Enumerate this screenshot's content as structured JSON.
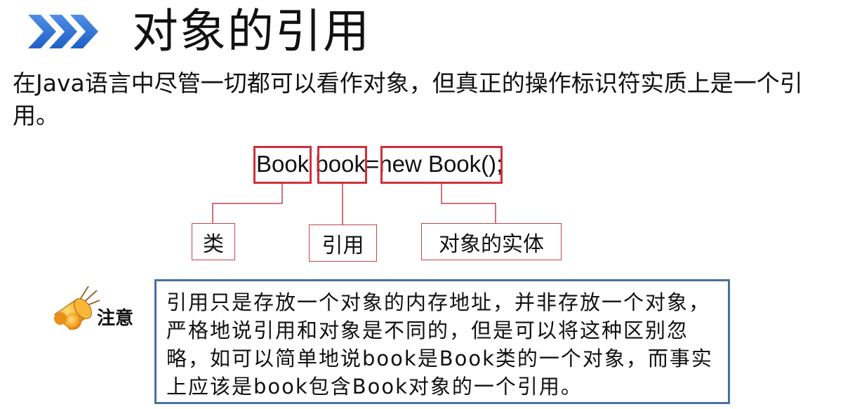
{
  "slide": {
    "title": "对象的引用",
    "intro": "在Java语言中尽管一切都可以看作对象，但真正的操作标识符实质上是一个引用。"
  },
  "diagram": {
    "code": {
      "part1": "Book",
      "part2": " book",
      "part3": "=",
      "part4": "new Book()",
      "part5": ";"
    },
    "labels": {
      "class": "类",
      "reference": "引用",
      "entity": "对象的实体"
    }
  },
  "note": {
    "label": "注意",
    "text": "引用只是存放一个对象的内存地址，并非存放一个对象，严格地说引用和对象是不同的，但是可以将这种区别忽略，如可以简单地说book是Book类的一个对象，而事实上应该是book包含Book对象的一个引用。"
  },
  "colors": {
    "accent_blue": "#2a6fd6",
    "highlight_red": "#d0303a",
    "note_border": "#4a6fa5"
  }
}
